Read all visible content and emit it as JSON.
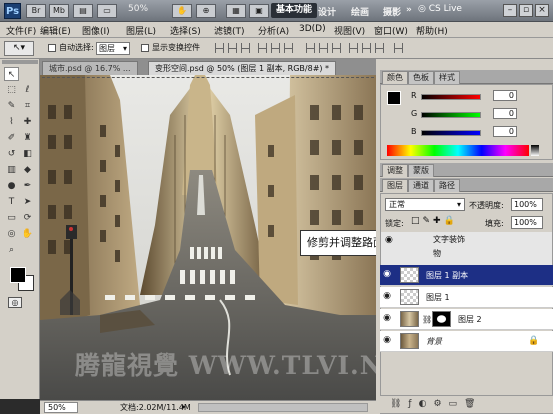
{
  "app": {
    "logo": "Ps",
    "zoom_readout": "50%",
    "workspaces": [
      "基本功能",
      "设计",
      "绘画",
      "摄影"
    ],
    "overflow_glyph": "»",
    "cs_live": "CS Live"
  },
  "menu": [
    "文件(F)",
    "编辑(E)",
    "图像(I)",
    "图层(L)",
    "选择(S)",
    "滤镜(T)",
    "分析(A)",
    "3D(D)",
    "视图(V)",
    "窗口(W)",
    "帮助(H)"
  ],
  "options": {
    "auto_select_label": "自动选择:",
    "auto_select_value": "图层",
    "show_transform_label": "显示变换控件"
  },
  "tabs": [
    {
      "label": "城市.psd @ 16.7% ...",
      "active": false
    },
    {
      "label": "变形空间.psd @ 50% (图层 1 副本, RGB/8#) *",
      "active": true
    }
  ],
  "tooltip": "修剪并调整路面形状",
  "watermark": "腾龍視覺 WWW.TLVI.NET",
  "status": {
    "zoom": "50%",
    "doc": "文档:2.02M/11.4M"
  },
  "color_panel": {
    "tabs": [
      "颜色",
      "色板",
      "样式"
    ],
    "channels": [
      {
        "label": "R",
        "value": "0"
      },
      {
        "label": "G",
        "value": "0"
      },
      {
        "label": "B",
        "value": "0"
      }
    ]
  },
  "adjust_tabs": [
    "调整",
    "蒙版"
  ],
  "layers_panel": {
    "tabs": [
      "图层",
      "通道",
      "路径"
    ],
    "blend_mode": "正常",
    "opacity_label": "不透明度:",
    "opacity": "100%",
    "lock_label": "锁定:",
    "fill_label": "填充:",
    "fill": "100%",
    "group_name": "文字装饰",
    "group_sub": "物",
    "layers": [
      {
        "name": "图层 1 副本",
        "selected": true
      },
      {
        "name": "图层 1",
        "selected": false
      },
      {
        "name": "图层 2",
        "selected": false
      },
      {
        "name": "背景",
        "selected": false
      }
    ]
  },
  "colors": {
    "accent": "#1d2f85",
    "panel": "#d4d0c8",
    "canvas_bg": "#767676"
  }
}
